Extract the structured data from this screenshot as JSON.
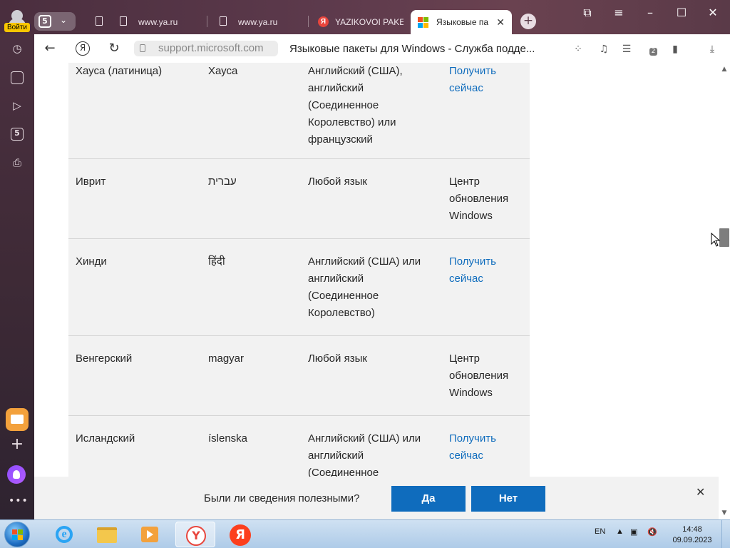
{
  "browser": {
    "profile_login_label": "Войти",
    "tab_count": "5",
    "tabs": [
      {
        "label": "www.ya.ru"
      },
      {
        "label": "www.ya.ru"
      },
      {
        "label": "YAZIKOVOI PAKE"
      },
      {
        "label": "Языковые па"
      }
    ],
    "url": "support.microsoft.com",
    "page_title": "Языковые пакеты для Windows - Служба подде...",
    "nav_yandex_label": "Я",
    "notifications_badge": "2",
    "sidebar_badge": "5"
  },
  "table": {
    "rows": [
      {
        "language": "Хауса (латиница)",
        "native": "Хауса",
        "base": "Английский (США), английский (Соединенное Королевство) или французский",
        "how": "Получить сейчас",
        "how_is_link": true
      },
      {
        "language": "Иврит",
        "native": "עברית",
        "base": "Любой язык",
        "how": "Центр обновления Windows",
        "how_is_link": false
      },
      {
        "language": "Хинди",
        "native": "हिंदी",
        "base": "Английский (США) или английский (Соединенное Королевство)",
        "how": "Получить сейчас",
        "how_is_link": true
      },
      {
        "language": "Венгерский",
        "native": "magyar",
        "base": "Любой язык",
        "how": "Центр обновления Windows",
        "how_is_link": false
      },
      {
        "language": "Исландский",
        "native": "íslenska",
        "base": "Английский (США) или английский (Соединенное",
        "how": "Получить сейчас",
        "how_is_link": true
      }
    ]
  },
  "feedback": {
    "question": "Были ли сведения полезными?",
    "yes_label": "Да",
    "no_label": "Нет"
  },
  "taskbar": {
    "language": "EN",
    "time": "14:48",
    "date": "09.09.2023",
    "yandex_letter": "Я"
  },
  "colors": {
    "link": "#0f6cbd",
    "button": "#0f6cbd",
    "table_bg": "#f2f2f2",
    "chrome_bg": "#5d3a4c"
  }
}
